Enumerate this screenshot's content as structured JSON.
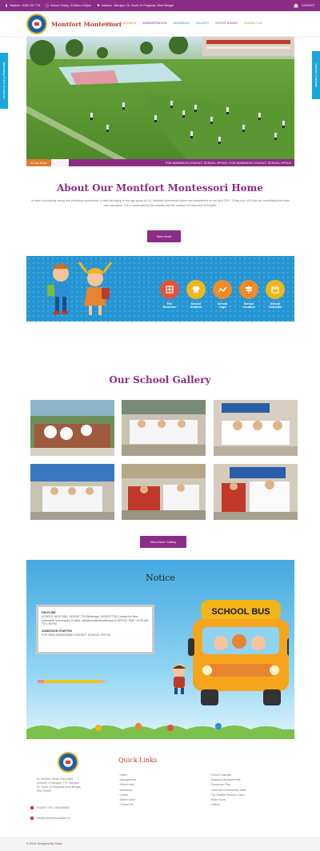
{
  "topbar": {
    "helpline": "Helpline : 9433 157 776",
    "timing": "School Timing : 8:30am-4:00pm",
    "address": "Address : Baruipur, Dt. South 24 Parganas, West Bengal",
    "contact": "CONTACT"
  },
  "header": {
    "site_name": "Montfort Montessori",
    "nav": [
      "HOME",
      "ACADEMICS",
      "ADMINISTRATION",
      "ADMISSION",
      "GALLERY",
      "NOTICE BOARD",
      "CONTACT US"
    ]
  },
  "side_tabs": {
    "left": "Mandatory Public Disclosure",
    "right": "Transfer Certificate"
  },
  "ticker": {
    "badge": "At Day News",
    "text": "FOR ADMISSION CONTACT SCHOOL OFFICE  •  FOR ADMISSION CONTACT SCHOOL OFFICE"
  },
  "about": {
    "title": "About Our Montfort Montessori Home",
    "text": "In view of providing caring and enriching experiences to kids belonging to the age group of 2-6, Montfort Montessori Home was established on the April 2011. Today over 400 kids are benefitting from their own education. It is a coeducational (for infants) and the medium of instruction is English.",
    "button": "View More"
  },
  "features": [
    {
      "label_1": "Fee",
      "label_2": "Structure",
      "color": "#e2533c",
      "icon": "fee-icon"
    },
    {
      "label_1": "School",
      "label_2": "Uniform",
      "color": "#f2b51a",
      "icon": "uniform-icon"
    },
    {
      "label_1": "School",
      "label_2": "Logo",
      "color": "#f08a2a",
      "icon": "logo-icon"
    },
    {
      "label_1": "School",
      "label_2": "Location",
      "color": "#f08a2a",
      "icon": "location-icon"
    },
    {
      "label_1": "School",
      "label_2": "Calendar",
      "color": "#f2b51a",
      "icon": "calendar-icon"
    }
  ],
  "gallery": {
    "title": "Our School Gallery",
    "button": "View More Gallery"
  },
  "notice": {
    "title": "Notice",
    "items": [
      {
        "heading": "HELPLINE",
        "text": "SCHOOL HELPLINE: 9433157776 (Whatsapp: 9433157776) Contact for New Admission and enquiry. E-MAIL: info@montfortmontessori.in OFFICE TIME: 10:30 AM TO 1:00 PM"
      },
      {
        "heading": "ADMISSION STARTED",
        "text": "FOR NEW ADMISSIONS CONTACT SCHOOL OFFICE"
      }
    ],
    "bus_label": "SCHOOL BUS"
  },
  "footer": {
    "quick_links_title": "Quick Links",
    "address": "St. Montfort Senior Secondary School(T-1) Baruipur, P.O. Baruipur, Dt. South 24 Parganas,West Bengal, PIN-743302",
    "phone": "9433157776 / 7044169838",
    "email": "info@montfortmontessori.in",
    "links_col1": [
      "Home",
      "Management",
      "What's new",
      "Admission",
      "Career",
      "Notice board",
      "Contact Us"
    ],
    "links_col2": [
      "School Calendar",
      "Awards & Achievements",
      "Classroom Plan",
      "Technical & Informative Staff",
      "Top Student Result in Class",
      "Rules Tools",
      "Gallery"
    ],
    "copyright_prefix": "© 2018, Designed By",
    "copyright_brand": "Glaxis"
  }
}
